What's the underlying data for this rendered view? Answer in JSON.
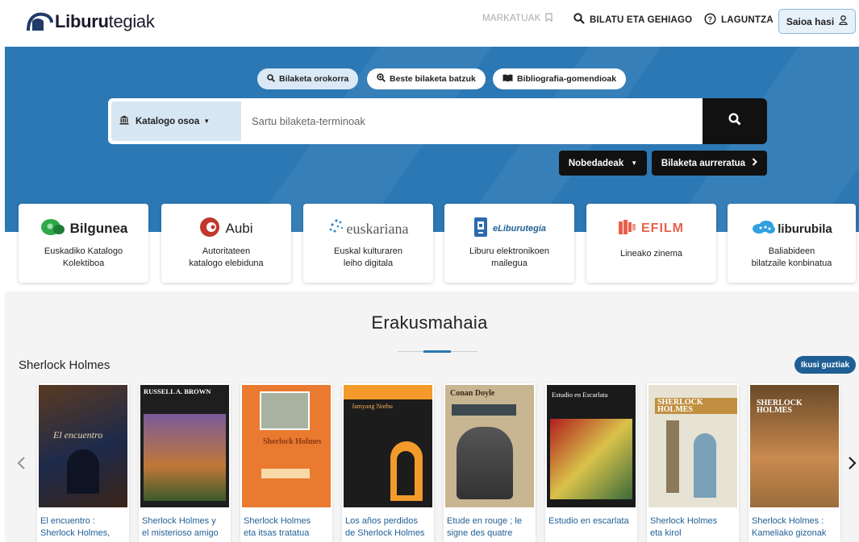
{
  "header": {
    "logo_bold": "Liburu",
    "logo_light": "tegiak",
    "markatuak": "MARKATUAK",
    "bilatu": "BILATU ETA GEHIAGO",
    "laguntza": "LAGUNTZA",
    "login": "Saioa hasi"
  },
  "hero": {
    "tabs": [
      "Bilaketa orokorra",
      "Beste bilaketa batzuk",
      "Bibliografia-gomendioak"
    ],
    "catalog_select": "Katalogo osoa",
    "search_placeholder": "Sartu bilaketa-terminoak",
    "nobedadeak": "Nobedadeak",
    "advanced": "Bilaketa aurreratua"
  },
  "cards": [
    {
      "brand": "Bilgunea",
      "desc1": "Euskadiko Katalogo",
      "desc2": "Kolektiboa"
    },
    {
      "brand": "Aubi",
      "desc1": "Autoritateen",
      "desc2": "katalogo elebiduna"
    },
    {
      "brand": "euskariana",
      "desc1": "Euskal kulturaren",
      "desc2": "leiho digitala"
    },
    {
      "brand": "eLiburutegia",
      "desc1": "Liburu elektronikoen",
      "desc2": "mailegua"
    },
    {
      "brand": "EFILM",
      "desc1": "Lineako zinema",
      "desc2": ""
    },
    {
      "brand": "liburubila",
      "desc1": "Baliabideen",
      "desc2": "bilatzaile konbinatua"
    }
  ],
  "showcase": {
    "title": "Erakusmahaia",
    "section": "Sherlock Holmes",
    "see_all": "Ikusi guztiak",
    "books": [
      {
        "title1": "El encuentro :",
        "title2": "Sherlock Holmes,",
        "cover_text": "El encuentro",
        "colors": [
          "#3a2418",
          "#1d2a4a"
        ]
      },
      {
        "title1": "Sherlock Holmes y",
        "title2": "el misterioso amigo",
        "cover_text": "RUSSELL A. BROWN",
        "colors": [
          "#2a2a2a",
          "#c07838"
        ]
      },
      {
        "title1": "Sherlock Holmes",
        "title2": "eta itsas tratatua",
        "cover_text": "Sherlock Holmes",
        "colors": [
          "#e8742e",
          "#f2a35c"
        ]
      },
      {
        "title1": "Los años perdidos",
        "title2": "de Sherlock Holmes",
        "cover_text": "Jamyang Norbu",
        "colors": [
          "#f39a2a",
          "#1c1c1c"
        ]
      },
      {
        "title1": "Etude en rouge ; le",
        "title2": "signe des quatre",
        "cover_text": "Conan Doyle",
        "colors": [
          "#c8b591",
          "#3f4a50"
        ]
      },
      {
        "title1": "Estudio en escarlata",
        "title2": "",
        "cover_text": "Estudio en Escarlata",
        "colors": [
          "#b01e1e",
          "#d9c24a"
        ]
      },
      {
        "title1": "Sherlock Holmes",
        "title2": "eta kirol",
        "cover_text": "SHERLOCK HOLMES",
        "colors": [
          "#d8d4c4",
          "#7aa1b8"
        ]
      },
      {
        "title1": "Sherlock Holmes :",
        "title2": "Kameliako gizonak",
        "cover_text": "SHERLOCK HOLMES",
        "colors": [
          "#9a6d3c",
          "#c98a4e"
        ]
      }
    ]
  }
}
